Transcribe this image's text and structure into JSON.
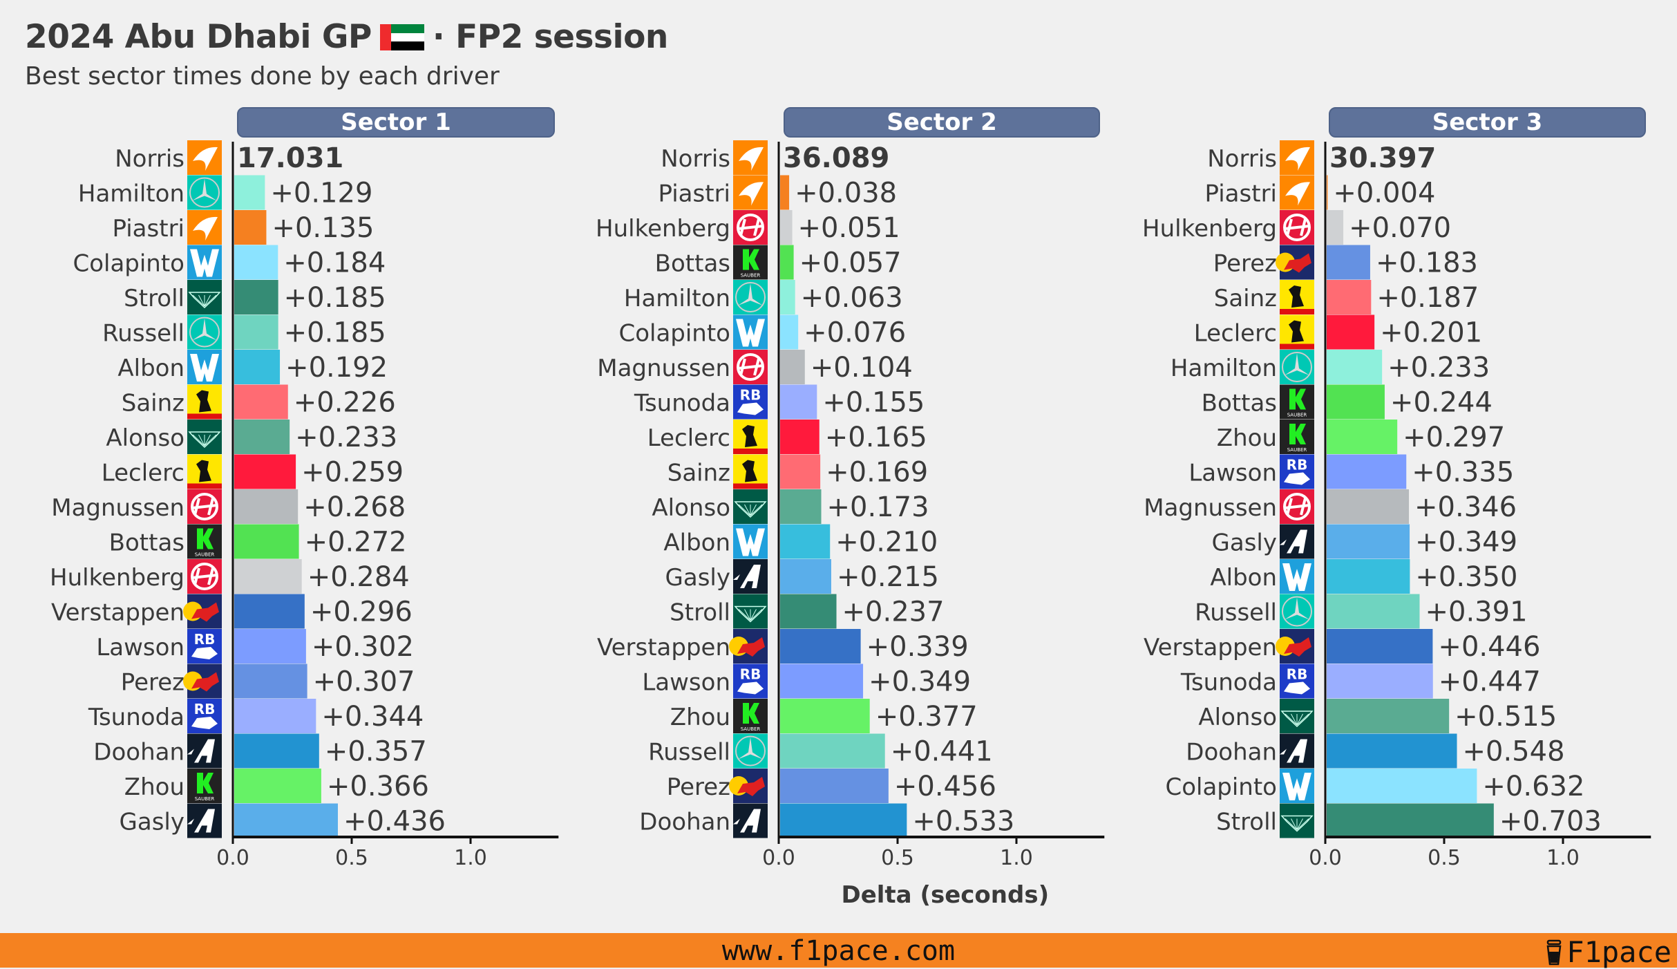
{
  "header": {
    "title_left": "2024 Abu Dhabi GP",
    "title_right": "· FP2 session",
    "flag_icon": "uae-flag-icon",
    "subtitle": "Best sector times done by each driver"
  },
  "footer": {
    "url": "www.f1pace.com",
    "brand": "F1pace",
    "brand_icon": "coffee-cup-icon",
    "color": "#f58220"
  },
  "team_colors": {
    "McLaren": "#f58020",
    "Mercedes": "#00d2be",
    "Williams": "#37bedd",
    "Aston Martin": "#358c75",
    "Ferrari": "#ff1a3c",
    "Haas": "#b6babd",
    "Kick Sauber": "#52e252",
    "Red Bull": "#3671c6",
    "RB": "#6692ff",
    "Alpine": "#2293d1"
  },
  "chart_data": [
    {
      "type": "bar",
      "orientation": "horizontal",
      "title": "Sector 1",
      "xlabel": "",
      "xlim": [
        0,
        1.37
      ],
      "xticks": [
        "0.0",
        "0.5",
        "1.0"
      ],
      "best_time_label": "17.031",
      "rows": [
        {
          "driver": "Norris",
          "team": "McLaren",
          "delta": 0.0,
          "label": "17.031",
          "color": "#f58020"
        },
        {
          "driver": "Hamilton",
          "team": "Mercedes",
          "delta": 0.129,
          "label": "+0.129",
          "color": "#8ef0dc"
        },
        {
          "driver": "Piastri",
          "team": "McLaren",
          "delta": 0.135,
          "label": "+0.135",
          "color": "#f58020"
        },
        {
          "driver": "Colapinto",
          "team": "Williams",
          "delta": 0.184,
          "label": "+0.184",
          "color": "#8be3ff"
        },
        {
          "driver": "Stroll",
          "team": "Aston Martin",
          "delta": 0.185,
          "label": "+0.185",
          "color": "#358c75"
        },
        {
          "driver": "Russell",
          "team": "Mercedes",
          "delta": 0.185,
          "label": "+0.185",
          "color": "#6fd4c0"
        },
        {
          "driver": "Albon",
          "team": "Williams",
          "delta": 0.192,
          "label": "+0.192",
          "color": "#37bedd"
        },
        {
          "driver": "Sainz",
          "team": "Ferrari",
          "delta": 0.226,
          "label": "+0.226",
          "color": "#ff6b73"
        },
        {
          "driver": "Alonso",
          "team": "Aston Martin",
          "delta": 0.233,
          "label": "+0.233",
          "color": "#5aab92"
        },
        {
          "driver": "Leclerc",
          "team": "Ferrari",
          "delta": 0.259,
          "label": "+0.259",
          "color": "#ff1a3c"
        },
        {
          "driver": "Magnussen",
          "team": "Haas",
          "delta": 0.268,
          "label": "+0.268",
          "color": "#b6babd"
        },
        {
          "driver": "Bottas",
          "team": "Kick Sauber",
          "delta": 0.272,
          "label": "+0.272",
          "color": "#52e252"
        },
        {
          "driver": "Hulkenberg",
          "team": "Haas",
          "delta": 0.284,
          "label": "+0.284",
          "color": "#cfd1d3"
        },
        {
          "driver": "Verstappen",
          "team": "Red Bull",
          "delta": 0.296,
          "label": "+0.296",
          "color": "#3671c6"
        },
        {
          "driver": "Lawson",
          "team": "RB",
          "delta": 0.302,
          "label": "+0.302",
          "color": "#7c9cff"
        },
        {
          "driver": "Perez",
          "team": "Red Bull",
          "delta": 0.307,
          "label": "+0.307",
          "color": "#6591e2"
        },
        {
          "driver": "Tsunoda",
          "team": "RB",
          "delta": 0.344,
          "label": "+0.344",
          "color": "#9aaeff"
        },
        {
          "driver": "Doohan",
          "team": "Alpine",
          "delta": 0.357,
          "label": "+0.357",
          "color": "#2293d1"
        },
        {
          "driver": "Zhou",
          "team": "Kick Sauber",
          "delta": 0.366,
          "label": "+0.366",
          "color": "#66f266"
        },
        {
          "driver": "Gasly",
          "team": "Alpine",
          "delta": 0.436,
          "label": "+0.436",
          "color": "#5aaeea"
        }
      ]
    },
    {
      "type": "bar",
      "orientation": "horizontal",
      "title": "Sector 2",
      "xlabel": "Delta (seconds)",
      "xlim": [
        0,
        1.37
      ],
      "xticks": [
        "0.0",
        "0.5",
        "1.0"
      ],
      "best_time_label": "36.089",
      "rows": [
        {
          "driver": "Norris",
          "team": "McLaren",
          "delta": 0.0,
          "label": "36.089",
          "color": "#f58020"
        },
        {
          "driver": "Piastri",
          "team": "McLaren",
          "delta": 0.038,
          "label": "+0.038",
          "color": "#f58020"
        },
        {
          "driver": "Hulkenberg",
          "team": "Haas",
          "delta": 0.051,
          "label": "+0.051",
          "color": "#cfd1d3"
        },
        {
          "driver": "Bottas",
          "team": "Kick Sauber",
          "delta": 0.057,
          "label": "+0.057",
          "color": "#52e252"
        },
        {
          "driver": "Hamilton",
          "team": "Mercedes",
          "delta": 0.063,
          "label": "+0.063",
          "color": "#8ef0dc"
        },
        {
          "driver": "Colapinto",
          "team": "Williams",
          "delta": 0.076,
          "label": "+0.076",
          "color": "#8be3ff"
        },
        {
          "driver": "Magnussen",
          "team": "Haas",
          "delta": 0.104,
          "label": "+0.104",
          "color": "#b6babd"
        },
        {
          "driver": "Tsunoda",
          "team": "RB",
          "delta": 0.155,
          "label": "+0.155",
          "color": "#9aaeff"
        },
        {
          "driver": "Leclerc",
          "team": "Ferrari",
          "delta": 0.165,
          "label": "+0.165",
          "color": "#ff1a3c"
        },
        {
          "driver": "Sainz",
          "team": "Ferrari",
          "delta": 0.169,
          "label": "+0.169",
          "color": "#ff6b73"
        },
        {
          "driver": "Alonso",
          "team": "Aston Martin",
          "delta": 0.173,
          "label": "+0.173",
          "color": "#5aab92"
        },
        {
          "driver": "Albon",
          "team": "Williams",
          "delta": 0.21,
          "label": "+0.210",
          "color": "#37bedd"
        },
        {
          "driver": "Gasly",
          "team": "Alpine",
          "delta": 0.215,
          "label": "+0.215",
          "color": "#5aaeea"
        },
        {
          "driver": "Stroll",
          "team": "Aston Martin",
          "delta": 0.237,
          "label": "+0.237",
          "color": "#358c75"
        },
        {
          "driver": "Verstappen",
          "team": "Red Bull",
          "delta": 0.339,
          "label": "+0.339",
          "color": "#3671c6"
        },
        {
          "driver": "Lawson",
          "team": "RB",
          "delta": 0.349,
          "label": "+0.349",
          "color": "#7c9cff"
        },
        {
          "driver": "Zhou",
          "team": "Kick Sauber",
          "delta": 0.377,
          "label": "+0.377",
          "color": "#66f266"
        },
        {
          "driver": "Russell",
          "team": "Mercedes",
          "delta": 0.441,
          "label": "+0.441",
          "color": "#6fd4c0"
        },
        {
          "driver": "Perez",
          "team": "Red Bull",
          "delta": 0.456,
          "label": "+0.456",
          "color": "#6591e2"
        },
        {
          "driver": "Doohan",
          "team": "Alpine",
          "delta": 0.533,
          "label": "+0.533",
          "color": "#2293d1"
        }
      ]
    },
    {
      "type": "bar",
      "orientation": "horizontal",
      "title": "Sector 3",
      "xlabel": "",
      "xlim": [
        0,
        1.37
      ],
      "xticks": [
        "0.0",
        "0.5",
        "1.0"
      ],
      "best_time_label": "30.397",
      "rows": [
        {
          "driver": "Norris",
          "team": "McLaren",
          "delta": 0.0,
          "label": "30.397",
          "color": "#f58020"
        },
        {
          "driver": "Piastri",
          "team": "McLaren",
          "delta": 0.004,
          "label": "+0.004",
          "color": "#f58020"
        },
        {
          "driver": "Hulkenberg",
          "team": "Haas",
          "delta": 0.07,
          "label": "+0.070",
          "color": "#cfd1d3"
        },
        {
          "driver": "Perez",
          "team": "Red Bull",
          "delta": 0.183,
          "label": "+0.183",
          "color": "#6591e2"
        },
        {
          "driver": "Sainz",
          "team": "Ferrari",
          "delta": 0.187,
          "label": "+0.187",
          "color": "#ff6b73"
        },
        {
          "driver": "Leclerc",
          "team": "Ferrari",
          "delta": 0.201,
          "label": "+0.201",
          "color": "#ff1a3c"
        },
        {
          "driver": "Hamilton",
          "team": "Mercedes",
          "delta": 0.233,
          "label": "+0.233",
          "color": "#8ef0dc"
        },
        {
          "driver": "Bottas",
          "team": "Kick Sauber",
          "delta": 0.244,
          "label": "+0.244",
          "color": "#52e252"
        },
        {
          "driver": "Zhou",
          "team": "Kick Sauber",
          "delta": 0.297,
          "label": "+0.297",
          "color": "#66f266"
        },
        {
          "driver": "Lawson",
          "team": "RB",
          "delta": 0.335,
          "label": "+0.335",
          "color": "#7c9cff"
        },
        {
          "driver": "Magnussen",
          "team": "Haas",
          "delta": 0.346,
          "label": "+0.346",
          "color": "#b6babd"
        },
        {
          "driver": "Gasly",
          "team": "Alpine",
          "delta": 0.349,
          "label": "+0.349",
          "color": "#5aaeea"
        },
        {
          "driver": "Albon",
          "team": "Williams",
          "delta": 0.35,
          "label": "+0.350",
          "color": "#37bedd"
        },
        {
          "driver": "Russell",
          "team": "Mercedes",
          "delta": 0.391,
          "label": "+0.391",
          "color": "#6fd4c0"
        },
        {
          "driver": "Verstappen",
          "team": "Red Bull",
          "delta": 0.446,
          "label": "+0.446",
          "color": "#3671c6"
        },
        {
          "driver": "Tsunoda",
          "team": "RB",
          "delta": 0.447,
          "label": "+0.447",
          "color": "#9aaeff"
        },
        {
          "driver": "Alonso",
          "team": "Aston Martin",
          "delta": 0.515,
          "label": "+0.515",
          "color": "#5aab92"
        },
        {
          "driver": "Doohan",
          "team": "Alpine",
          "delta": 0.548,
          "label": "+0.548",
          "color": "#2293d1"
        },
        {
          "driver": "Colapinto",
          "team": "Williams",
          "delta": 0.632,
          "label": "+0.632",
          "color": "#8be3ff"
        },
        {
          "driver": "Stroll",
          "team": "Aston Martin",
          "delta": 0.703,
          "label": "+0.703",
          "color": "#358c75"
        }
      ]
    }
  ]
}
